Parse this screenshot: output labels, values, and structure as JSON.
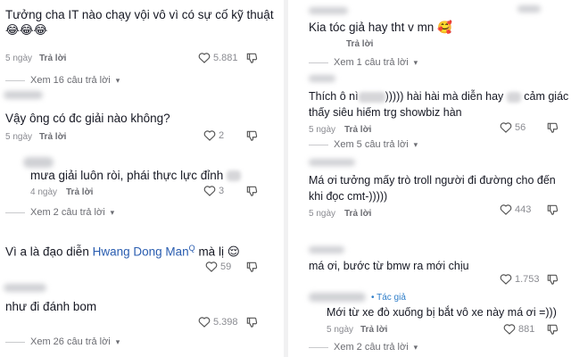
{
  "left": {
    "c1": {
      "text": "Tưởng cha IT nào chạy vội vô vì có sự cố kỹ thuật",
      "emoji": "😂😂😂",
      "time": "5 ngày",
      "reply": "Trả lời",
      "likes": "5.881",
      "view_more": "Xem 16 câu trả lời"
    },
    "c2": {
      "text": "Vậy ông có đc giải nào không?",
      "time": "5 ngày",
      "reply": "Trả lời",
      "likes": "2"
    },
    "c3": {
      "text": "mưa giải luôn ròi, phái thực lực đỉnh",
      "time": "4 ngày",
      "reply": "Trả lời",
      "likes": "3",
      "view_more": "Xem 2 câu trả lời"
    },
    "c4": {
      "text_a": "Vì a là đạo diễn",
      "link": "Hwang Dong Man",
      "text_b": "mà lị",
      "emoji": "😌",
      "likes": "59"
    },
    "c5": {
      "text": "như đi đánh bom",
      "likes": "5.398",
      "view_more": "Xem 26 câu trả lời"
    }
  },
  "right": {
    "c1": {
      "text": "Kia tóc giả hay tht v mn",
      "emoji": "🥰",
      "reply": "Trả lời",
      "view_more": "Xem 1 câu trả lời"
    },
    "c2": {
      "text_a": "Thích ô nì",
      "text_b": ")))))  hài hài mà diễn hay",
      "text_c": "cảm giác",
      "text_d": "thấy siêu hiếm trg showbiz hàn",
      "time": "5 ngày",
      "reply": "Trả lời",
      "likes": "56",
      "view_more": "Xem 5 câu trả lời"
    },
    "c3": {
      "text_a": "Má ơi tưởng mấy trò troll người đi đường cho đến",
      "text_b": "khi đọc cmt-)))))",
      "time": "5 ngày",
      "reply": "Trả lời",
      "likes": "443"
    },
    "c4": {
      "text": "má ơi, bước từ bmw ra mới chịu",
      "likes": "1.753"
    },
    "c5": {
      "author_tag": "Tác giả",
      "text": "Mới từ xe đò xuống bị bắt vô xe này má ơi =)))",
      "time": "5 ngày",
      "reply": "Trả lời",
      "likes": "881",
      "view_more": "Xem 2 câu trả lời"
    }
  },
  "icons": {
    "heart": "heart-outline-icon",
    "dislike": "thumbs-down-icon",
    "chevron": "chevron-down-icon"
  }
}
